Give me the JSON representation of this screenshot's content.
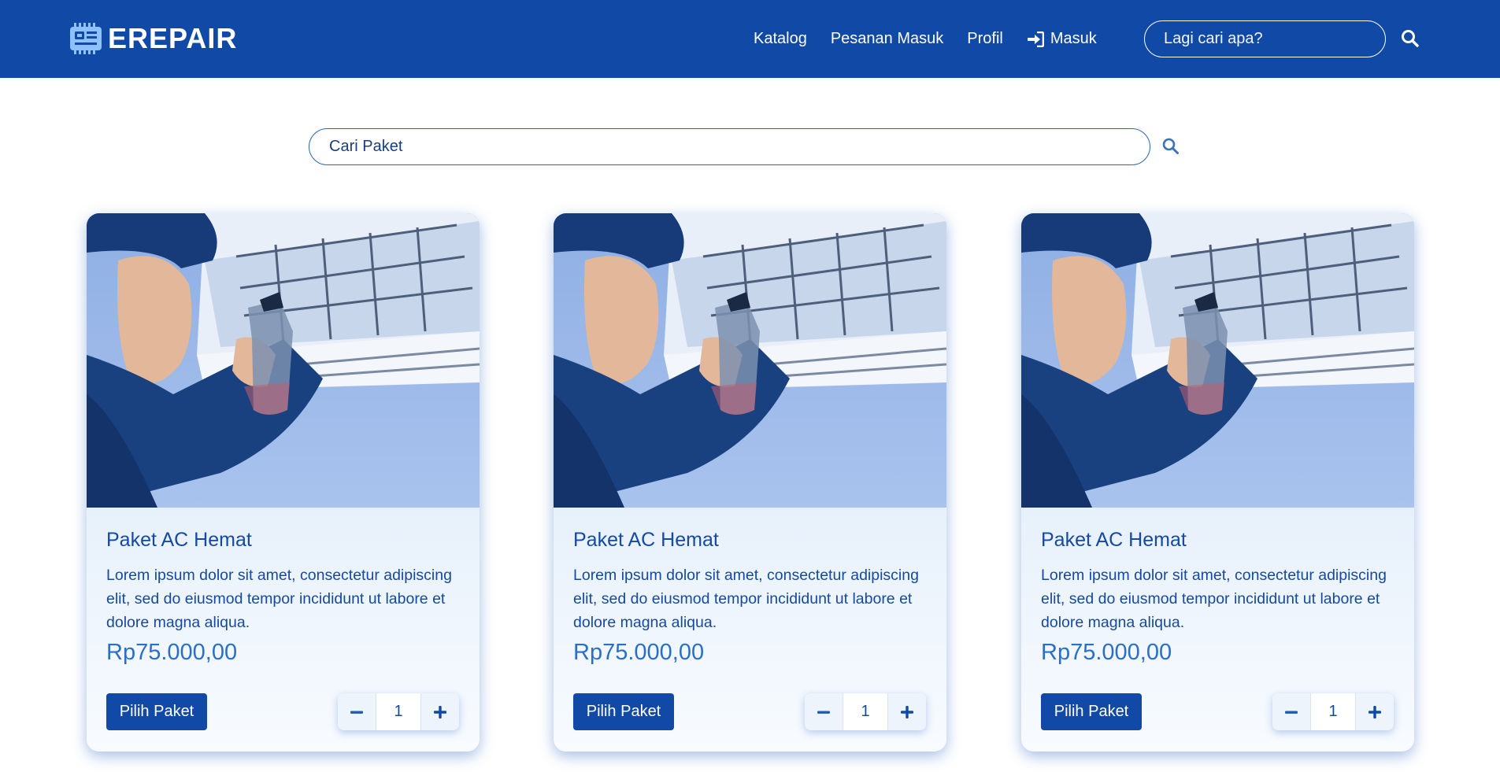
{
  "header": {
    "brand": "EREPAIR",
    "nav": [
      {
        "label": "Katalog"
      },
      {
        "label": "Pesanan Masuk"
      },
      {
        "label": "Profil"
      },
      {
        "label": "Masuk",
        "icon": "sign-in-icon"
      }
    ],
    "search_placeholder": "Lagi cari apa?",
    "search_icon": "search-icon"
  },
  "main": {
    "search_placeholder": "Cari Paket",
    "search_icon": "search-icon"
  },
  "cards": [
    {
      "image": "technician-cleaning-ac-photo",
      "title": "Paket AC Hemat",
      "description": "Lorem ipsum dolor sit amet, consectetur adipiscing elit, sed do eiusmod tempor incididunt ut labore et dolore magna aliqua.",
      "price": "Rp75.000,00",
      "button_label": "Pilih Paket",
      "quantity": "1"
    },
    {
      "image": "technician-cleaning-ac-photo",
      "title": "Paket AC Hemat",
      "description": "Lorem ipsum dolor sit amet, consectetur adipiscing elit, sed do eiusmod tempor incididunt ut labore et dolore magna aliqua.",
      "price": "Rp75.000,00",
      "button_label": "Pilih Paket",
      "quantity": "1"
    },
    {
      "image": "technician-cleaning-ac-photo",
      "title": "Paket AC Hemat",
      "description": "Lorem ipsum dolor sit amet, consectetur adipiscing elit, sed do eiusmod tempor incididunt ut labore et dolore magna aliqua.",
      "price": "Rp75.000,00",
      "button_label": "Pilih Paket",
      "quantity": "1"
    }
  ],
  "colors": {
    "header_bg": "#1049a6",
    "accent": "#1049a6",
    "price": "#2b6fc4",
    "text": "#1549a2"
  }
}
